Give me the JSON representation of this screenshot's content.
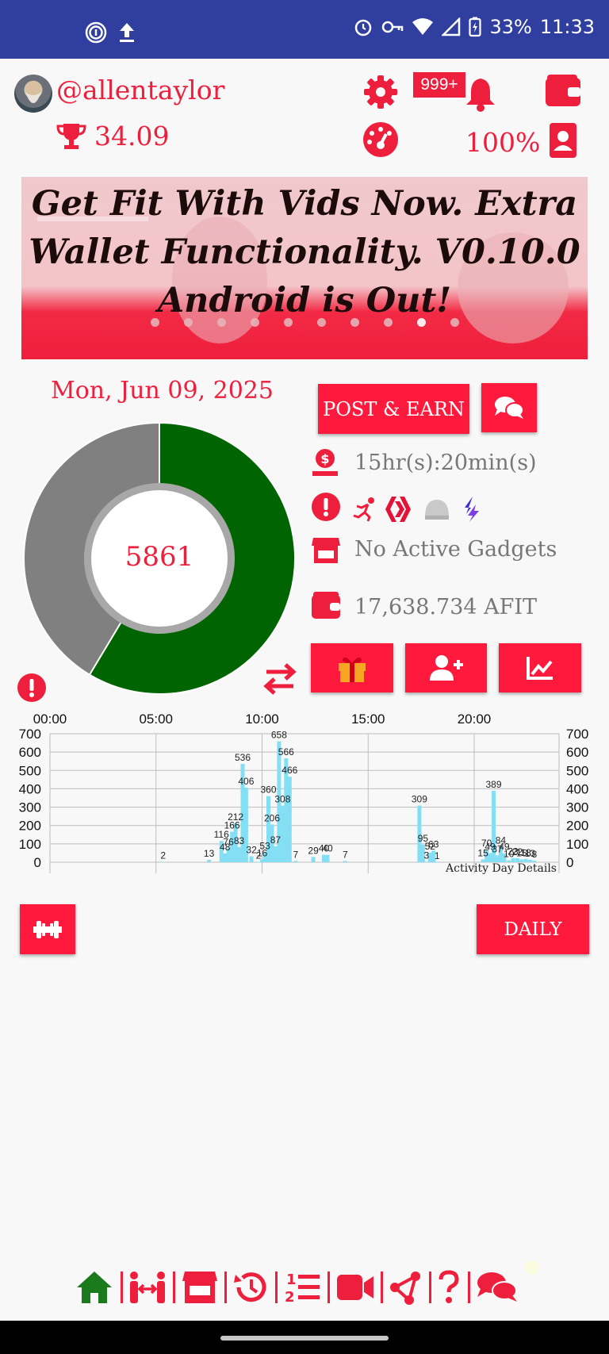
{
  "status_bar": {
    "left_icons": [
      "fingerprint-icon",
      "upload-icon"
    ],
    "right_icons": [
      "alarm-icon",
      "vpn-key-icon",
      "wifi-icon",
      "signal-icon",
      "battery-charging-icon"
    ],
    "battery": "33%",
    "time": "11:33"
  },
  "profile": {
    "username": "@allentaylor",
    "trophy_score": "34.09",
    "notification_badge": "999+",
    "percent": "100%"
  },
  "banner": {
    "text": "Get Fit With Vids Now. Extra Wallet Functionality. V0.10.0 Android is Out!",
    "slide_count": 10,
    "active_slide": 9
  },
  "summary": {
    "date": "Mon, Jun 09, 2025",
    "steps": "5861",
    "progress_fraction": 0.586,
    "post_earn_label": "POST & EARN",
    "time_left": "15hr(s):20min(s)",
    "gadgets_text": "No Active Gadgets",
    "wallet_balance": "17,638.734 AFIT"
  },
  "chart_data": {
    "type": "bar",
    "title": "Activity Day Details",
    "x_ticks": [
      "00:00",
      "05:00",
      "10:00",
      "15:00",
      "20:00"
    ],
    "y_ticks": [
      "700",
      "600",
      "500",
      "400",
      "300",
      "200",
      "100",
      "0"
    ],
    "ylim": [
      0,
      700
    ],
    "xlim_minutes": [
      0,
      1440
    ],
    "bar_color": "#84dff5",
    "bars": [
      {
        "t": 320,
        "v": 2,
        "label": "2"
      },
      {
        "t": 450,
        "v": 13,
        "label": "13"
      },
      {
        "t": 485,
        "v": 116,
        "label": "116"
      },
      {
        "t": 495,
        "v": 48,
        "label": "48"
      },
      {
        "t": 505,
        "v": 76,
        "label": "76"
      },
      {
        "t": 515,
        "v": 166,
        "label": "166"
      },
      {
        "t": 525,
        "v": 212,
        "label": "212"
      },
      {
        "t": 535,
        "v": 83,
        "label": "83"
      },
      {
        "t": 545,
        "v": 536,
        "label": "536"
      },
      {
        "t": 555,
        "v": 406,
        "label": "406"
      },
      {
        "t": 570,
        "v": 32,
        "label": "32"
      },
      {
        "t": 590,
        "v": 2,
        "label": "2"
      },
      {
        "t": 600,
        "v": 16,
        "label": "16"
      },
      {
        "t": 608,
        "v": 53,
        "label": "53"
      },
      {
        "t": 618,
        "v": 360,
        "label": "360"
      },
      {
        "t": 628,
        "v": 206,
        "label": "206"
      },
      {
        "t": 638,
        "v": 87,
        "label": "87"
      },
      {
        "t": 648,
        "v": 658,
        "label": "658"
      },
      {
        "t": 658,
        "v": 308,
        "label": "308"
      },
      {
        "t": 668,
        "v": 566,
        "label": "566"
      },
      {
        "t": 678,
        "v": 466,
        "label": "466"
      },
      {
        "t": 695,
        "v": 7,
        "label": "7"
      },
      {
        "t": 745,
        "v": 29,
        "label": "29"
      },
      {
        "t": 775,
        "v": 40,
        "label": "40"
      },
      {
        "t": 785,
        "v": 40,
        "label": "40"
      },
      {
        "t": 835,
        "v": 7,
        "label": "7"
      },
      {
        "t": 1045,
        "v": 309,
        "label": "309"
      },
      {
        "t": 1055,
        "v": 95,
        "label": "95"
      },
      {
        "t": 1065,
        "v": 3,
        "label": "3"
      },
      {
        "t": 1075,
        "v": 52,
        "label": "52"
      },
      {
        "t": 1085,
        "v": 63,
        "label": "63"
      },
      {
        "t": 1095,
        "v": 1,
        "label": "1"
      },
      {
        "t": 1225,
        "v": 15,
        "label": "15"
      },
      {
        "t": 1235,
        "v": 70,
        "label": "70"
      },
      {
        "t": 1245,
        "v": 49,
        "label": "49"
      },
      {
        "t": 1255,
        "v": 389,
        "label": "389"
      },
      {
        "t": 1265,
        "v": 37,
        "label": "37"
      },
      {
        "t": 1275,
        "v": 84,
        "label": "84"
      },
      {
        "t": 1285,
        "v": 49,
        "label": "49"
      },
      {
        "t": 1298,
        "v": 10,
        "label": "10"
      },
      {
        "t": 1310,
        "v": 23,
        "label": "23"
      },
      {
        "t": 1322,
        "v": 22,
        "label": "22"
      },
      {
        "t": 1334,
        "v": 15,
        "label": "15"
      },
      {
        "t": 1346,
        "v": 18,
        "label": "18"
      },
      {
        "t": 1358,
        "v": 13,
        "label": "13"
      },
      {
        "t": 1370,
        "v": 8,
        "label": "8"
      }
    ]
  },
  "actions": {
    "daily_label": "DAILY"
  },
  "bottom_nav": [
    "home-icon",
    "people-arrows-icon",
    "store-icon",
    "history-icon",
    "ranking-list-icon",
    "video-icon",
    "share-icon",
    "help-icon",
    "chat-icon"
  ],
  "colors": {
    "accent": "#ff1a3d",
    "status_bar": "#303f9f",
    "progress_done": "#006400",
    "progress_remaining": "#808080",
    "nav_active": "#1b7a1b"
  }
}
